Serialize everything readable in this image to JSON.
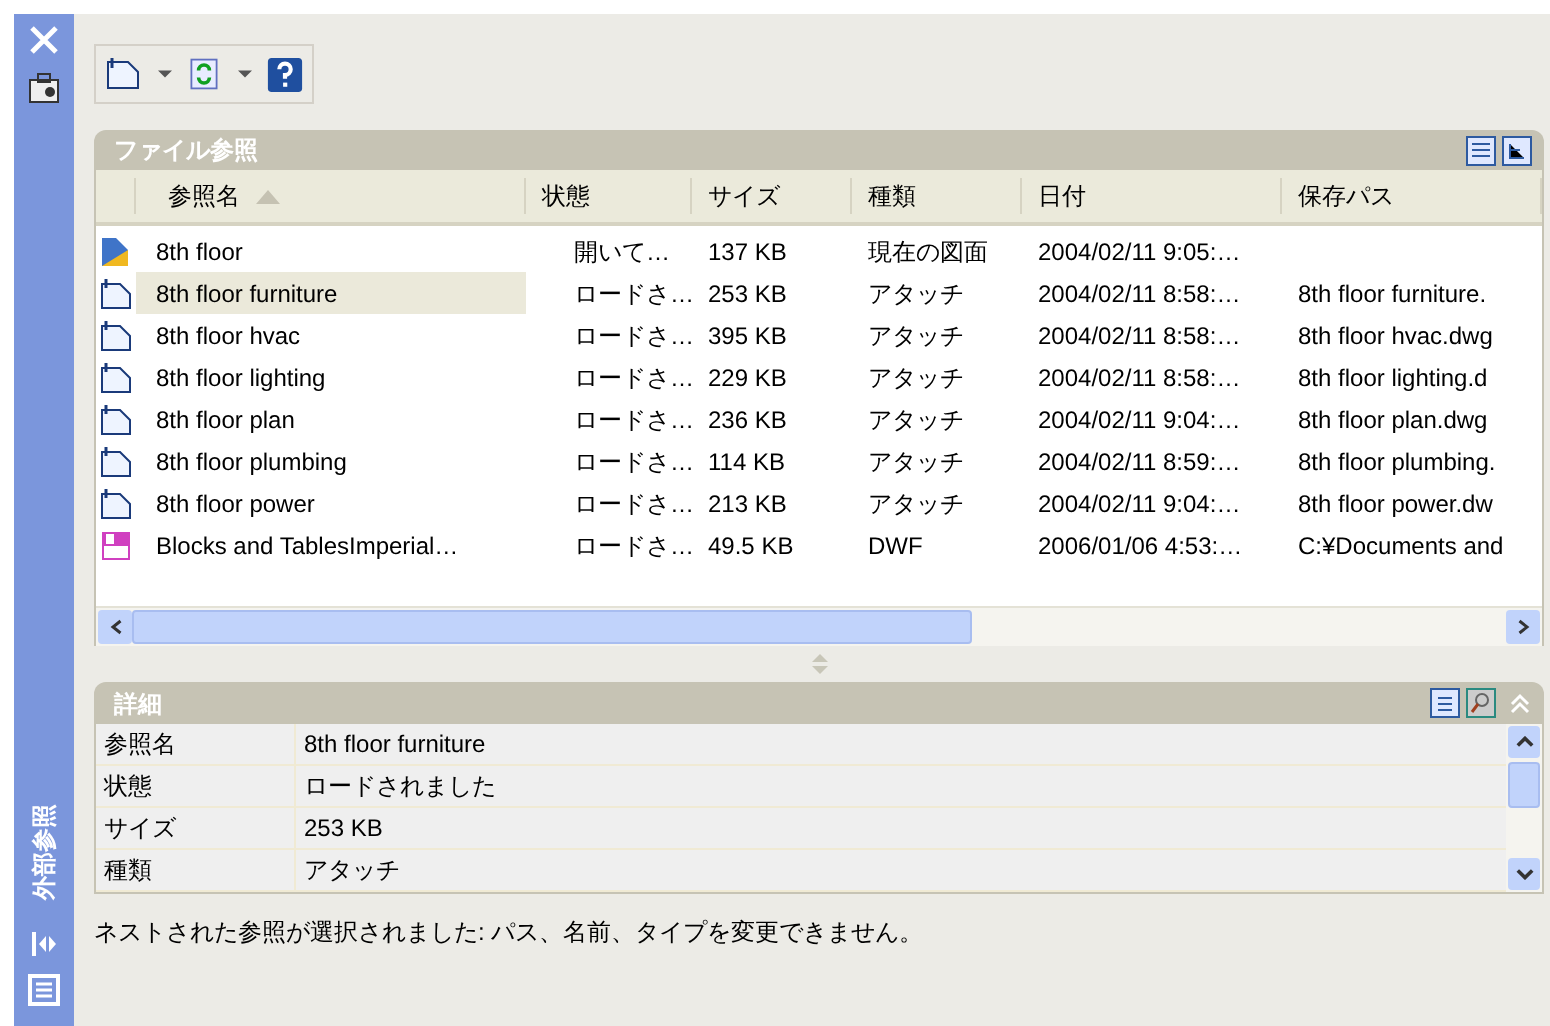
{
  "sidebar": {
    "title": "外部参照"
  },
  "file_panel": {
    "title": "ファイル参照",
    "columns": [
      {
        "label": "参照名",
        "sorted": true
      },
      {
        "label": "状態",
        "sorted": false
      },
      {
        "label": "サイズ",
        "sorted": false
      },
      {
        "label": "種類",
        "sorted": false
      },
      {
        "label": "日付",
        "sorted": false
      },
      {
        "label": "保存パス",
        "sorted": false
      }
    ],
    "rows": [
      {
        "kind": "drawing",
        "name": "8th floor",
        "status": "開いて…",
        "size": "137 KB",
        "type": "現在の図面",
        "date": "2004/02/11 9:05:…",
        "selected": false
      },
      {
        "kind": "attach",
        "name": "8th floor furniture",
        "status": "ロードさ…",
        "size": "253 KB",
        "type": "アタッチ",
        "date": "2004/02/11 8:58:…",
        "path": "8th floor furniture.",
        "selected": true
      },
      {
        "kind": "attach",
        "name": "8th floor hvac",
        "status": "ロードさ…",
        "size": "395 KB",
        "type": "アタッチ",
        "date": "2004/02/11 8:58:…",
        "path": "8th floor hvac.dwg",
        "selected": false
      },
      {
        "kind": "attach",
        "name": "8th floor lighting",
        "status": "ロードさ…",
        "size": "229 KB",
        "type": "アタッチ",
        "date": "2004/02/11 8:58:…",
        "path": "8th floor lighting.d",
        "selected": false
      },
      {
        "kind": "attach",
        "name": "8th floor plan",
        "status": "ロードさ…",
        "size": "236 KB",
        "type": "アタッチ",
        "date": "2004/02/11 9:04:…",
        "path": "8th floor plan.dwg",
        "selected": false
      },
      {
        "kind": "attach",
        "name": "8th floor plumbing",
        "status": "ロードさ…",
        "size": "114 KB",
        "type": "アタッチ",
        "date": "2004/02/11 8:59:…",
        "path": "8th floor plumbing.",
        "selected": false
      },
      {
        "kind": "attach",
        "name": "8th floor power",
        "status": "ロードさ…",
        "size": "213 KB",
        "type": "アタッチ",
        "date": "2004/02/11 9:04:…",
        "path": "8th floor power.dw",
        "selected": false
      },
      {
        "kind": "dwf",
        "name": "Blocks and TablesImperial…",
        "status": "ロードさ…",
        "size": "49.5 KB",
        "type": "DWF",
        "date": "2006/01/06 4:53:…",
        "path": "C:¥Documents and",
        "selected": false
      }
    ]
  },
  "details": {
    "title": "詳細",
    "rows": [
      {
        "label": "参照名",
        "value": "8th floor furniture"
      },
      {
        "label": "状態",
        "value": "ロードされました"
      },
      {
        "label": "サイズ",
        "value": "253 KB"
      },
      {
        "label": "種類",
        "value": "アタッチ"
      }
    ]
  },
  "status_message": "ネストされた参照が選択されました: パス、名前、タイプを変更できません。"
}
